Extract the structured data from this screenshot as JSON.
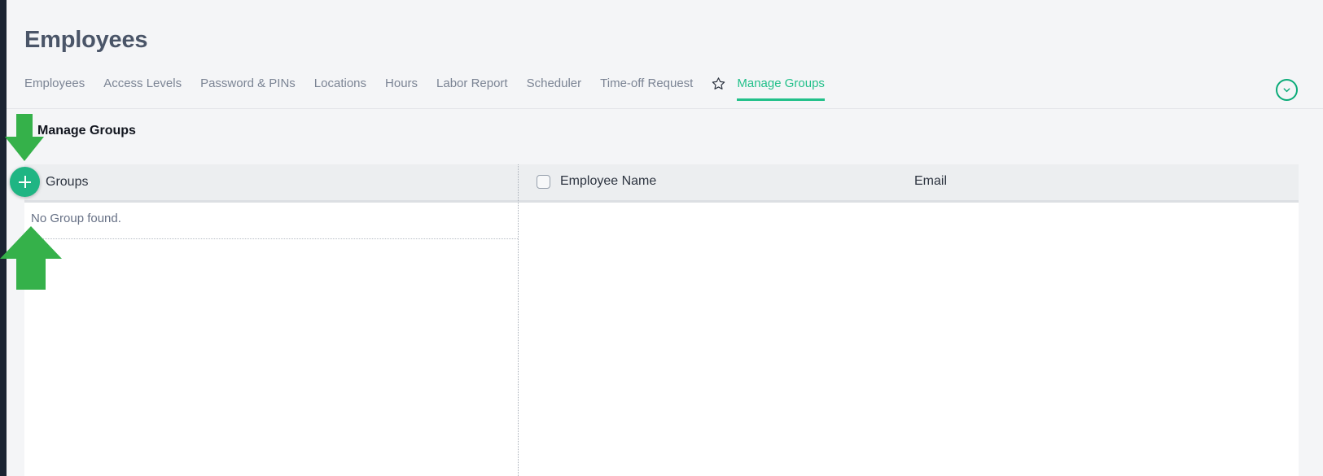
{
  "page": {
    "title": "Employees"
  },
  "tabs": [
    {
      "label": "Employees",
      "active": false
    },
    {
      "label": "Access Levels",
      "active": false
    },
    {
      "label": "Password & PINs",
      "active": false
    },
    {
      "label": "Locations",
      "active": false
    },
    {
      "label": "Hours",
      "active": false
    },
    {
      "label": "Labor Report",
      "active": false
    },
    {
      "label": "Scheduler",
      "active": false
    },
    {
      "label": "Time-off Request",
      "active": false
    },
    {
      "label": "Manage Groups",
      "active": true
    }
  ],
  "icons": {
    "favorite": "star-outline-icon",
    "collapse": "chevron-down-icon",
    "add": "plus-icon"
  },
  "subheader": {
    "title": "Manage Groups"
  },
  "groups_panel": {
    "header": "Groups",
    "empty_message": "No Group found."
  },
  "employees_panel": {
    "columns": [
      "Employee Name",
      "Email"
    ],
    "select_all_checked": false,
    "rows": []
  },
  "annotations": [
    {
      "name": "arrow-down-to-add-button",
      "direction": "down"
    },
    {
      "name": "arrow-up-to-group-list",
      "direction": "up"
    }
  ],
  "colors": {
    "accent_green": "#22c08a",
    "button_green": "#1fb583",
    "arrow_green": "#35b14a",
    "title_slate": "#4a5568",
    "page_bg": "#f4f5f7",
    "rail_dark": "#1b2432"
  }
}
